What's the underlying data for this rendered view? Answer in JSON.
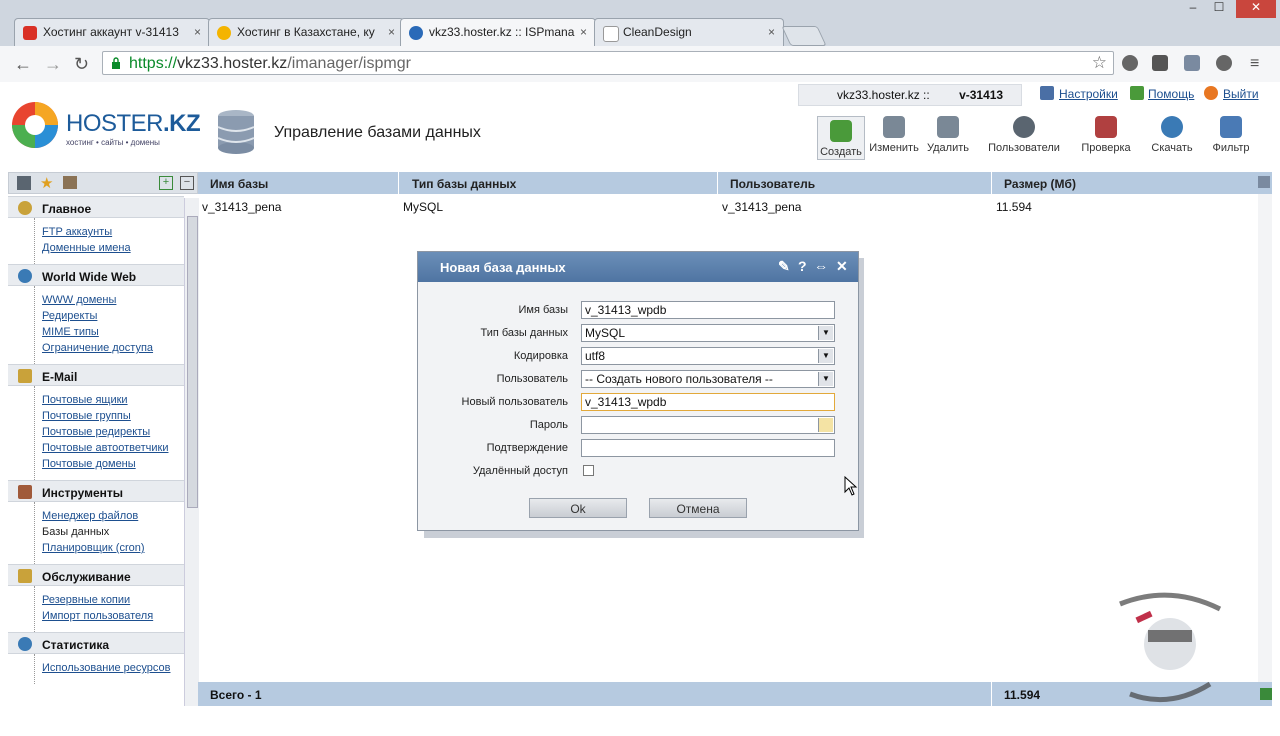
{
  "browser": {
    "tabs": [
      {
        "title": "Хостинг аккаунт v-31413",
        "icon_color": "#d93025"
      },
      {
        "title": "Хостинг в Казахстане, ку",
        "icon_color": "#f4b400"
      },
      {
        "title": "vkz33.hoster.kz :: ISPmana",
        "icon_color": "#2a6ab8"
      },
      {
        "title": "CleanDesign",
        "icon_color": "#999999"
      }
    ],
    "tab_close": "×",
    "window_controls": [
      "–",
      "☐",
      "✕"
    ],
    "url_scheme": "https://",
    "url_host": "vkz33.hoster.kz",
    "url_path": "/imanager/ispmgr",
    "back": "←",
    "forward": "→",
    "reload": "↻",
    "star": "☆",
    "menu": "≡"
  },
  "header": {
    "brand": "HOSTER",
    "brand_tld": ".KZ",
    "brand_sub": "хостинг • сайты • домены",
    "page_title": "Управление базами данных",
    "server": "vkz33.hoster.kz ::",
    "user": "v-31413",
    "links": {
      "settings": "Настройки",
      "help": "Помощь",
      "logout": "Выйти"
    }
  },
  "toolbar": [
    {
      "label": "Создать",
      "icon": "create-icon",
      "color": "#4a9a3a"
    },
    {
      "label": "Изменить",
      "icon": "edit-icon",
      "color": "#7a8896"
    },
    {
      "label": "Удалить",
      "icon": "delete-icon",
      "color": "#7a8896"
    },
    {
      "label": "Пользователи",
      "icon": "users-icon",
      "color": "#5a6570"
    },
    {
      "label": "Проверка",
      "icon": "check-icon",
      "color": "#b04040"
    },
    {
      "label": "Скачать",
      "icon": "download-icon",
      "color": "#3a7ab5"
    },
    {
      "label": "Фильтр",
      "icon": "filter-icon",
      "color": "#4a7ab5"
    }
  ],
  "sidebar": {
    "sections": [
      {
        "title": "Главное",
        "items": [
          "FTP аккаунты",
          "Доменные имена"
        ]
      },
      {
        "title": "World Wide Web",
        "items": [
          "WWW домены",
          "Редиректы",
          "MIME типы",
          "Ограничение доступа"
        ]
      },
      {
        "title": "E-Mail",
        "items": [
          "Почтовые ящики",
          "Почтовые группы",
          "Почтовые редиректы",
          "Почтовые автоответчики",
          "Почтовые домены"
        ]
      },
      {
        "title": "Инструменты",
        "items": [
          "Менеджер файлов",
          "Базы данных",
          "Планировщик (cron)"
        ]
      },
      {
        "title": "Обслуживание",
        "items": [
          "Резервные копии",
          "Импорт пользователя"
        ]
      },
      {
        "title": "Статистика",
        "items": [
          "Использование ресурсов"
        ]
      }
    ],
    "active_item": "Базы данных"
  },
  "table": {
    "columns": [
      "Имя базы",
      "Тип базы данных",
      "Пользователь",
      "Размер (Мб)"
    ],
    "rows": [
      [
        "v_31413_pena",
        "MySQL",
        "v_31413_pena",
        "11.594"
      ]
    ],
    "footer_label": "Всего - 1",
    "footer_total": "11.594"
  },
  "dialog": {
    "title": "Новая база данных",
    "fields": {
      "db_name": {
        "label": "Имя базы",
        "value": "v_31413_wpdb"
      },
      "db_type": {
        "label": "Тип базы данных",
        "value": "MySQL"
      },
      "charset": {
        "label": "Кодировка",
        "value": "utf8"
      },
      "user": {
        "label": "Пользователь",
        "value": "-- Создать нового пользователя --"
      },
      "new_user": {
        "label": "Новый пользователь",
        "value": "v_31413_wpdb"
      },
      "password": {
        "label": "Пароль",
        "value": ""
      },
      "confirm": {
        "label": "Подтверждение",
        "value": ""
      },
      "remote": {
        "label": "Удалённый доступ",
        "checked": false
      }
    },
    "ok": "Ok",
    "cancel": "Отмена"
  }
}
